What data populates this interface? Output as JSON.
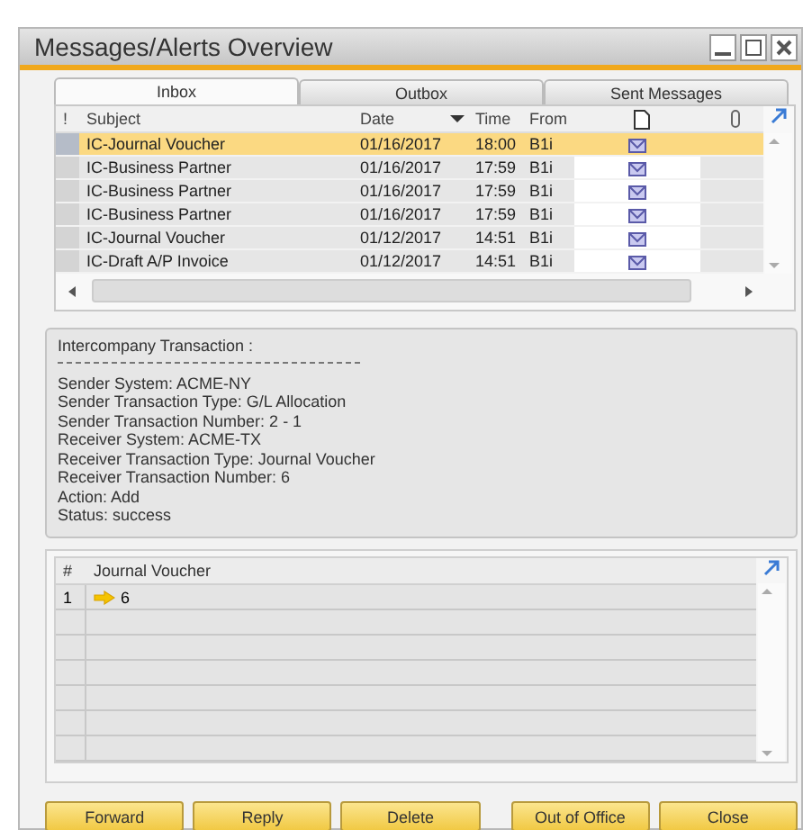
{
  "window": {
    "title": "Messages/Alerts Overview"
  },
  "tabs": [
    {
      "label": "Inbox",
      "selected": true
    },
    {
      "label": "Outbox",
      "selected": false
    },
    {
      "label": "Sent Messages",
      "selected": false
    }
  ],
  "messages": {
    "columns": [
      {
        "label": "!",
        "sorted": false
      },
      {
        "label": "Subject",
        "sorted": false
      },
      {
        "label": "Date",
        "sorted": true
      },
      {
        "label": "Time",
        "sorted": false
      },
      {
        "label": "From",
        "sorted": false
      }
    ],
    "rows": [
      {
        "subject": "IC-Journal Voucher",
        "date": "01/16/2017",
        "time": "18:00",
        "from": "B1i",
        "selected": true
      },
      {
        "subject": "IC-Business Partner",
        "date": "01/16/2017",
        "time": "17:59",
        "from": "B1i",
        "selected": false
      },
      {
        "subject": "IC-Business Partner",
        "date": "01/16/2017",
        "time": "17:59",
        "from": "B1i",
        "selected": false
      },
      {
        "subject": "IC-Business Partner",
        "date": "01/16/2017",
        "time": "17:59",
        "from": "B1i",
        "selected": false
      },
      {
        "subject": "IC-Journal Voucher",
        "date": "01/12/2017",
        "time": "14:51",
        "from": "B1i",
        "selected": false
      },
      {
        "subject": "IC-Draft A/P Invoice",
        "date": "01/12/2017",
        "time": "14:51",
        "from": "B1i",
        "selected": false
      }
    ]
  },
  "details": {
    "heading": "Intercompany Transaction :",
    "lines": [
      "Sender System: ACME-NY",
      "Sender Transaction Type: G/L Allocation",
      "Sender Transaction Number: 2 - 1",
      "Receiver System: ACME-TX",
      "Receiver Transaction Type: Journal Voucher",
      "Receiver Transaction Number: 6",
      "Action: Add",
      "Status: success"
    ]
  },
  "links": {
    "columns": [
      "#",
      "Journal Voucher"
    ],
    "rows": [
      {
        "number": "1",
        "value": "6"
      }
    ]
  },
  "buttons": [
    "Forward",
    "Reply",
    "Delete",
    "Out of Office",
    "Close"
  ]
}
